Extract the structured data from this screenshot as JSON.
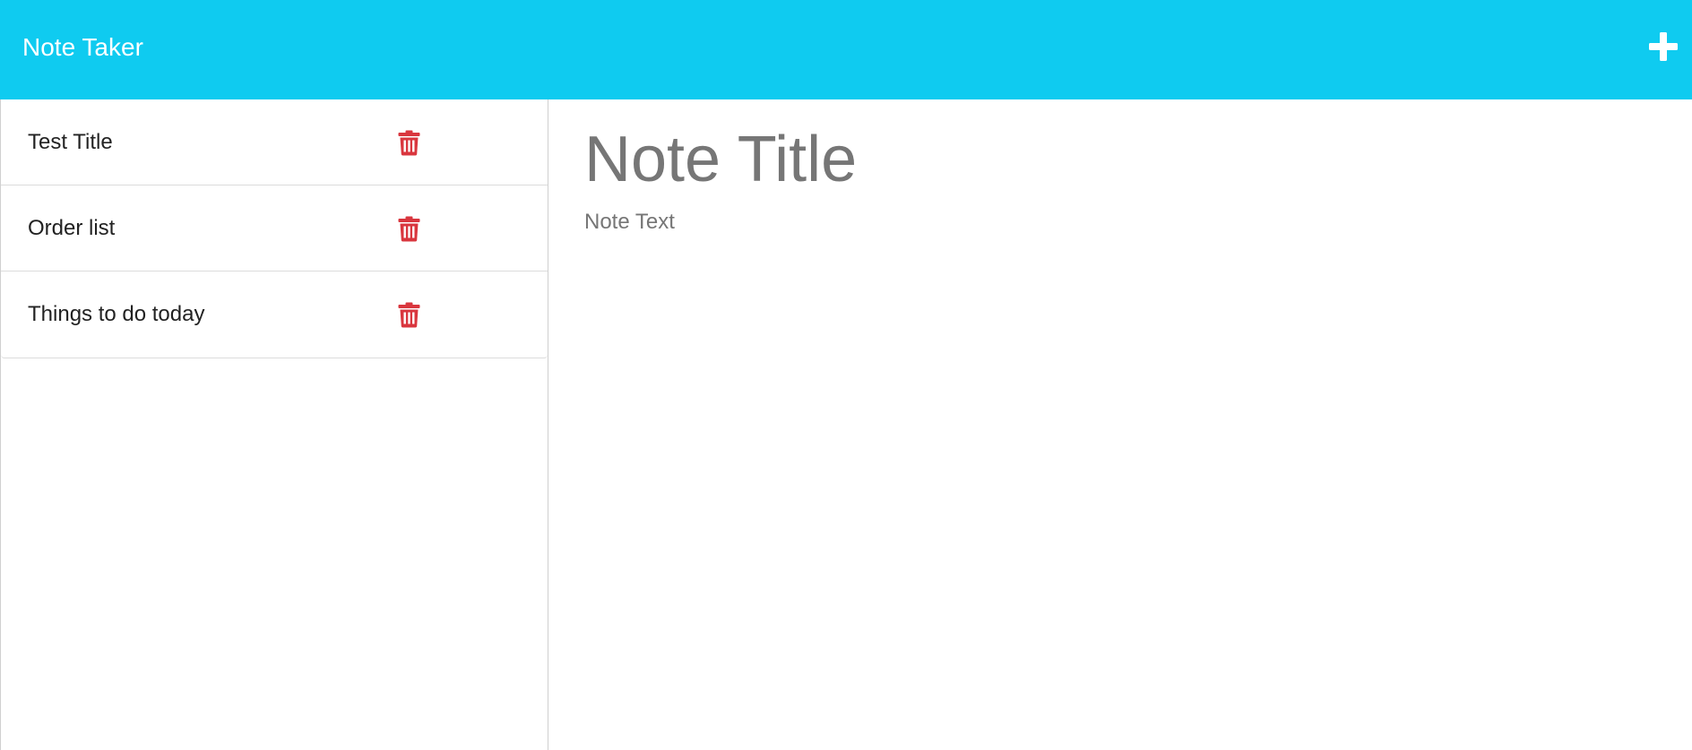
{
  "header": {
    "brand": "Note Taker",
    "new_note_icon": "plus-icon",
    "background_color": "#0fcbf0"
  },
  "sidebar": {
    "delete_icon": "trash-icon",
    "delete_color": "#d9363e",
    "notes": [
      {
        "title": "Test Title"
      },
      {
        "title": "Order list"
      },
      {
        "title": "Things to do today"
      }
    ]
  },
  "editor": {
    "title_value": "",
    "title_placeholder": "Note Title",
    "text_value": "",
    "text_placeholder": "Note Text"
  }
}
